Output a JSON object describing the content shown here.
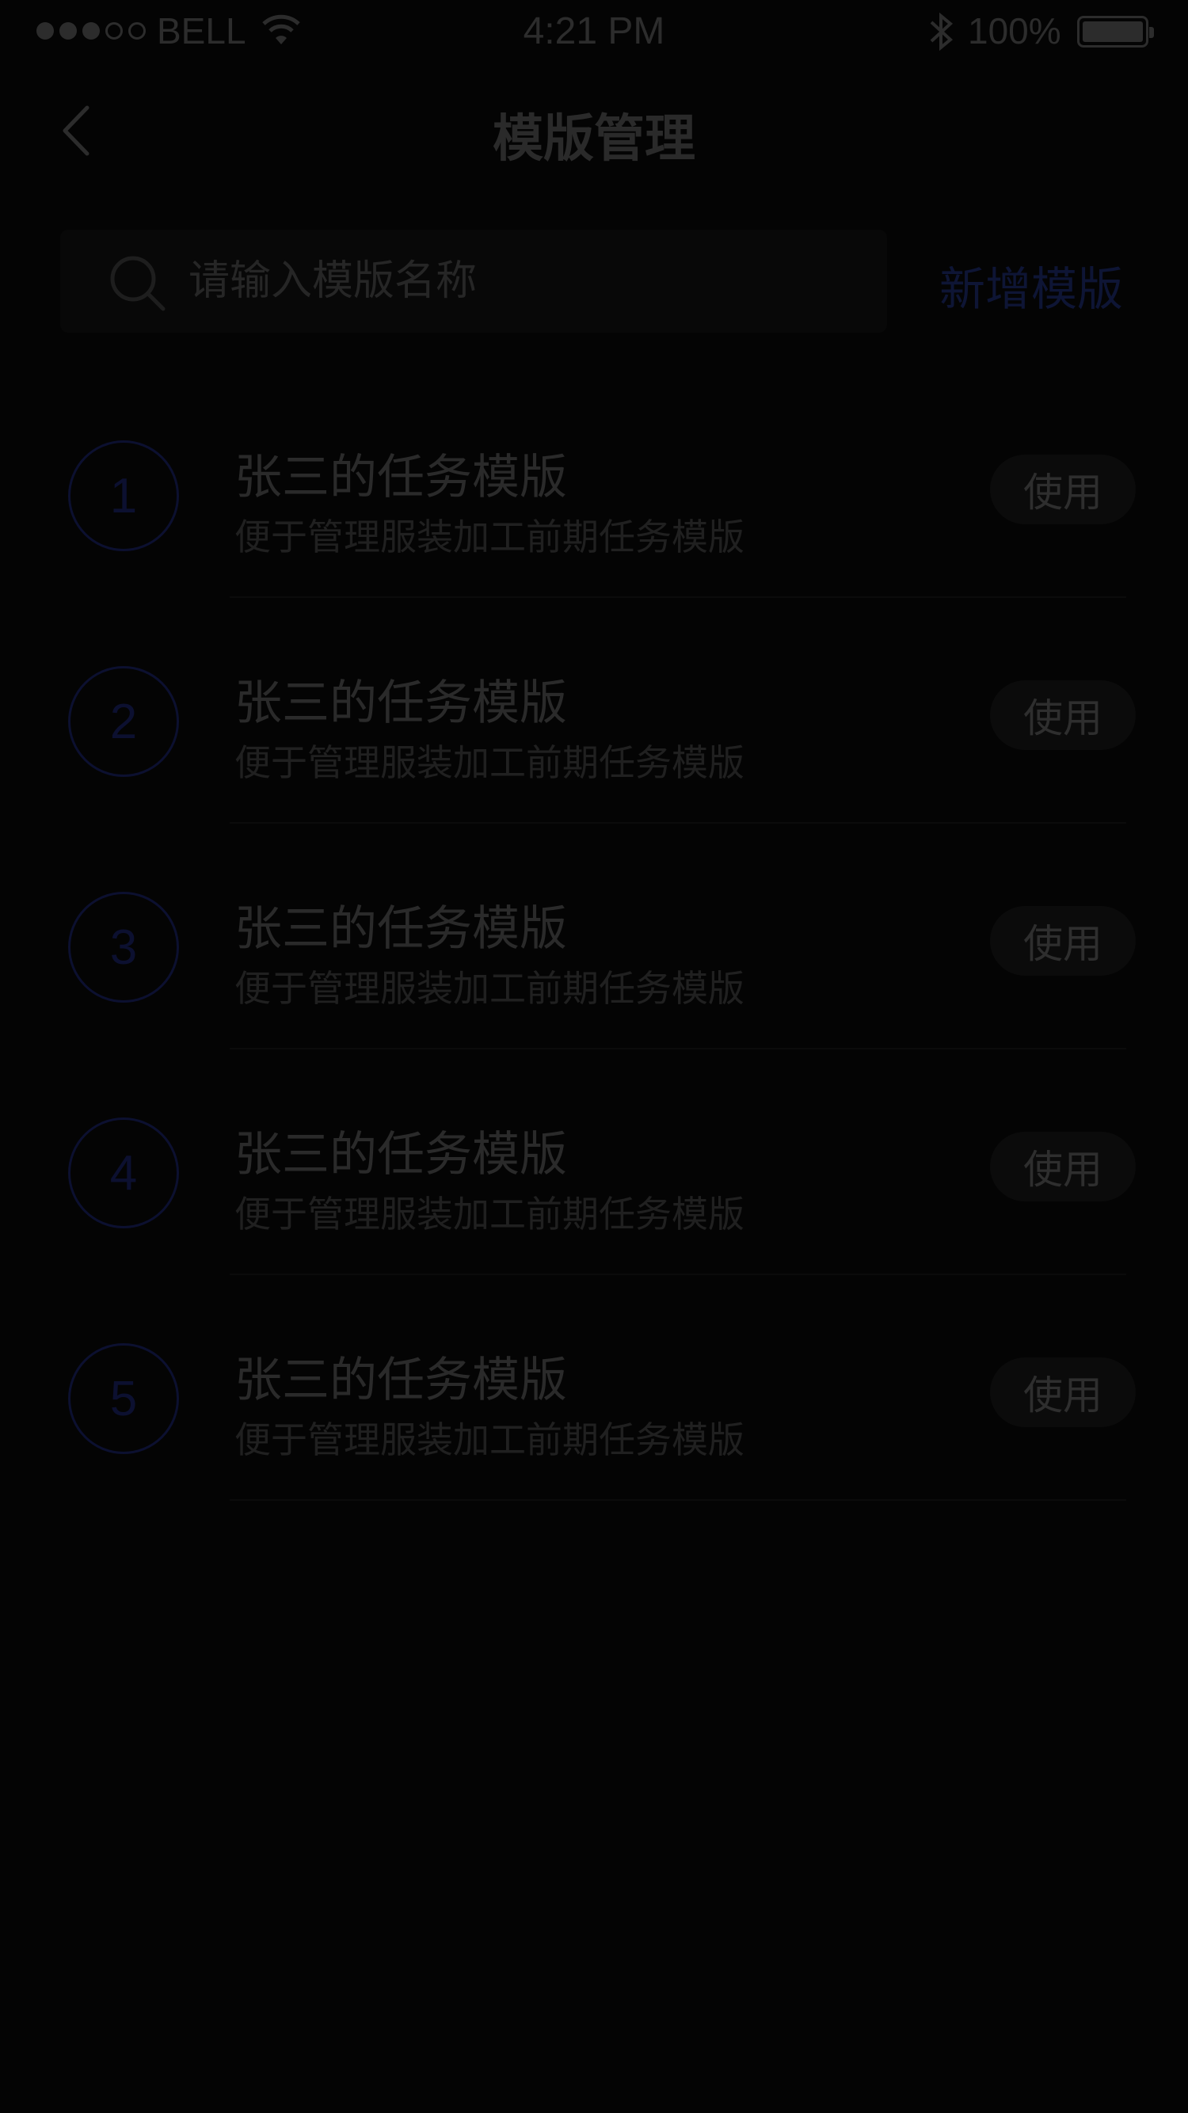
{
  "status_bar": {
    "carrier": "BELL",
    "time": "4:21 PM",
    "battery": "100%"
  },
  "nav": {
    "title": "模版管理"
  },
  "search": {
    "placeholder": "请输入模版名称",
    "add_label": "新增模版"
  },
  "templates": [
    {
      "number": "1",
      "title": "张三的任务模版",
      "description": "便于管理服装加工前期任务模版",
      "action": "使用"
    },
    {
      "number": "2",
      "title": "张三的任务模版",
      "description": "便于管理服装加工前期任务模版",
      "action": "使用"
    },
    {
      "number": "3",
      "title": "张三的任务模版",
      "description": "便于管理服装加工前期任务模版",
      "action": "使用"
    },
    {
      "number": "4",
      "title": "张三的任务模版",
      "description": "便于管理服装加工前期任务模版",
      "action": "使用"
    },
    {
      "number": "5",
      "title": "张三的任务模版",
      "description": "便于管理服装加工前期任务模版",
      "action": "使用"
    }
  ],
  "colors": {
    "background": "#040404",
    "accent": "#0c1030"
  }
}
